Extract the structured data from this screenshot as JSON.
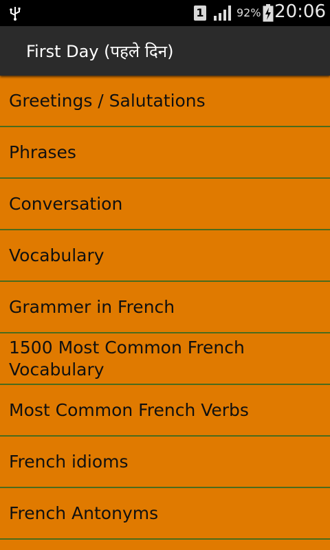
{
  "status_bar": {
    "sim_slot": "1",
    "battery_percent": "92%",
    "time": "20:06"
  },
  "action_bar": {
    "title": "First Day (पहले दिन)"
  },
  "menu": {
    "items": [
      {
        "label": "Greetings / Salutations"
      },
      {
        "label": "Phrases"
      },
      {
        "label": "Conversation"
      },
      {
        "label": "Vocabulary"
      },
      {
        "label": "Grammer in French"
      },
      {
        "label": "1500 Most Common French Vocabulary"
      },
      {
        "label": "Most Common French Verbs"
      },
      {
        "label": "French idioms"
      },
      {
        "label": "French Antonyms"
      }
    ]
  },
  "colors": {
    "item_background": "#e07a00",
    "divider": "#4a6b1c",
    "action_bar": "#2b2b2b",
    "status_bar": "#000000"
  }
}
